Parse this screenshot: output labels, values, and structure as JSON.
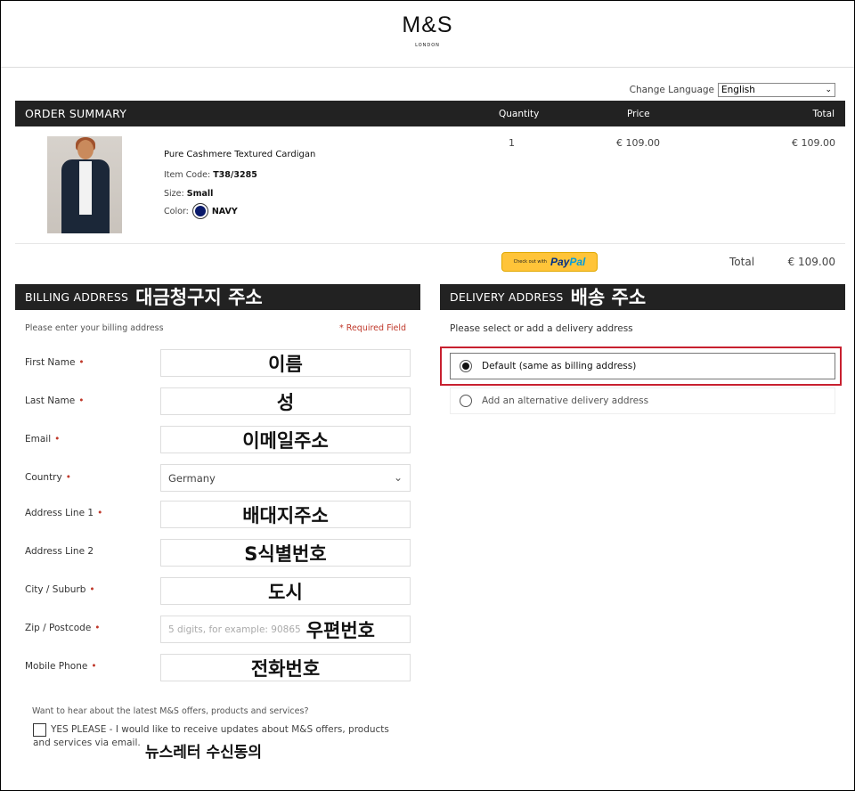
{
  "brand": {
    "logo": "M&S",
    "sub": "LONDON"
  },
  "language": {
    "label": "Change Language",
    "selected": "English"
  },
  "order_summary": {
    "title": "ORDER SUMMARY",
    "col_quantity": "Quantity",
    "col_price": "Price",
    "col_total": "Total",
    "item": {
      "name": "Pure Cashmere Textured Cardigan",
      "code_label": "Item Code:",
      "code": "T38/3285",
      "size_label": "Size:",
      "size": "Small",
      "color_label": "Color:",
      "color": "NAVY",
      "color_hex": "#0a1a6b",
      "quantity": "1",
      "price": "€ 109.00",
      "total": "€ 109.00"
    },
    "paypal": {
      "small": "Check out with",
      "pay": "Pay",
      "pal": "Pal"
    },
    "total_label": "Total",
    "total_value": "€ 109.00"
  },
  "billing": {
    "title": "BILLING ADDRESS",
    "title_ko": "대금청구지 주소",
    "hint": "Please enter your billing address",
    "required": "* Required Field",
    "fields": [
      {
        "label": "First Name",
        "required": "•",
        "value": "이름"
      },
      {
        "label": "Last Name",
        "required": "•",
        "value": "성"
      },
      {
        "label": "Email",
        "required": "•",
        "value": "이메일주소"
      },
      {
        "label": "Country",
        "required": "•",
        "value": "Germany"
      },
      {
        "label": "Address Line 1",
        "required": "•",
        "value": "배대지주소"
      },
      {
        "label": "Address Line 2",
        "required": "",
        "value": "S식별번호"
      },
      {
        "label": "City / Suburb",
        "required": "•",
        "value": "도시"
      },
      {
        "label": "Zip / Postcode",
        "required": "•",
        "placeholder": "5 digits, for example: 90865",
        "value": "우편번호"
      },
      {
        "label": "Mobile Phone",
        "required": "•",
        "value": "전화번호"
      }
    ],
    "newsletter": {
      "question": "Want to hear about the latest M&S offers, products and services?",
      "line1": "YES PLEASE - I would like to receive updates about M&S offers, products",
      "line2": "and services via email.",
      "note_ko": "뉴스레터 수신동의"
    }
  },
  "delivery": {
    "title": "DELIVERY ADDRESS",
    "title_ko": "배송 주소",
    "hint": "Please select or add a delivery address",
    "options": [
      {
        "label": "Default (same as billing address)",
        "selected": true
      },
      {
        "label": "Add an alternative delivery address",
        "selected": false
      }
    ]
  },
  "colors": {
    "bar_bg": "#222222",
    "required_red": "#c0392b",
    "highlight": "#c8202f",
    "paypal_yellow": "#ffc439"
  }
}
